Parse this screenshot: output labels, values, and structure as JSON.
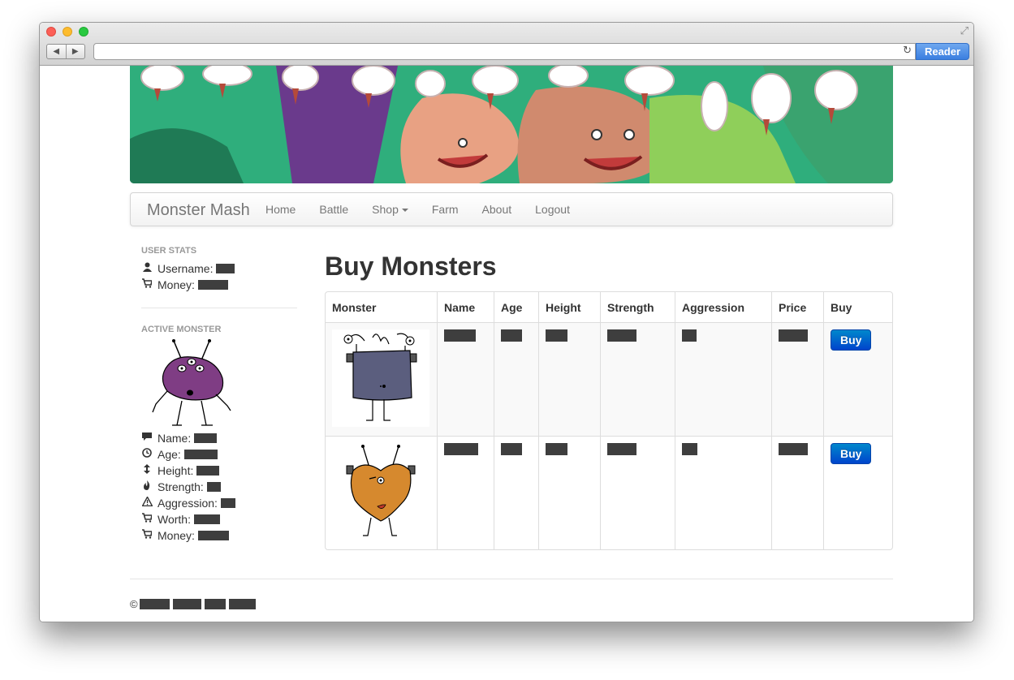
{
  "browser": {
    "reader_label": "Reader",
    "back_glyph": "◀",
    "forward_glyph": "▶",
    "reload_glyph": "↻",
    "fullscreen_glyph": "⤢"
  },
  "navbar": {
    "brand": "Monster Mash",
    "links": [
      "Home",
      "Battle",
      "Shop",
      "Farm",
      "About",
      "Logout"
    ]
  },
  "sidebar": {
    "user_stats_header": "USER STATS",
    "username_label": "Username:",
    "money_label": "Money:",
    "active_monster_header": "ACTIVE MONSTER",
    "monster_stats": {
      "name_label": "Name:",
      "age_label": "Age:",
      "height_label": "Height:",
      "strength_label": "Strength:",
      "aggression_label": "Aggression:",
      "worth_label": "Worth:",
      "money_label": "Money:"
    }
  },
  "main": {
    "title": "Buy Monsters",
    "columns": [
      "Monster",
      "Name",
      "Age",
      "Height",
      "Strength",
      "Aggression",
      "Price",
      "Buy"
    ],
    "buy_label": "Buy"
  },
  "footer": {
    "copyright_symbol": "©"
  },
  "colors": {
    "primary_button": "#0074cc",
    "purple_monster": "#7f3d84",
    "slate_monster": "#5b5e7e",
    "orange_monster": "#d6892e",
    "banner_green": "#2fae7c"
  }
}
